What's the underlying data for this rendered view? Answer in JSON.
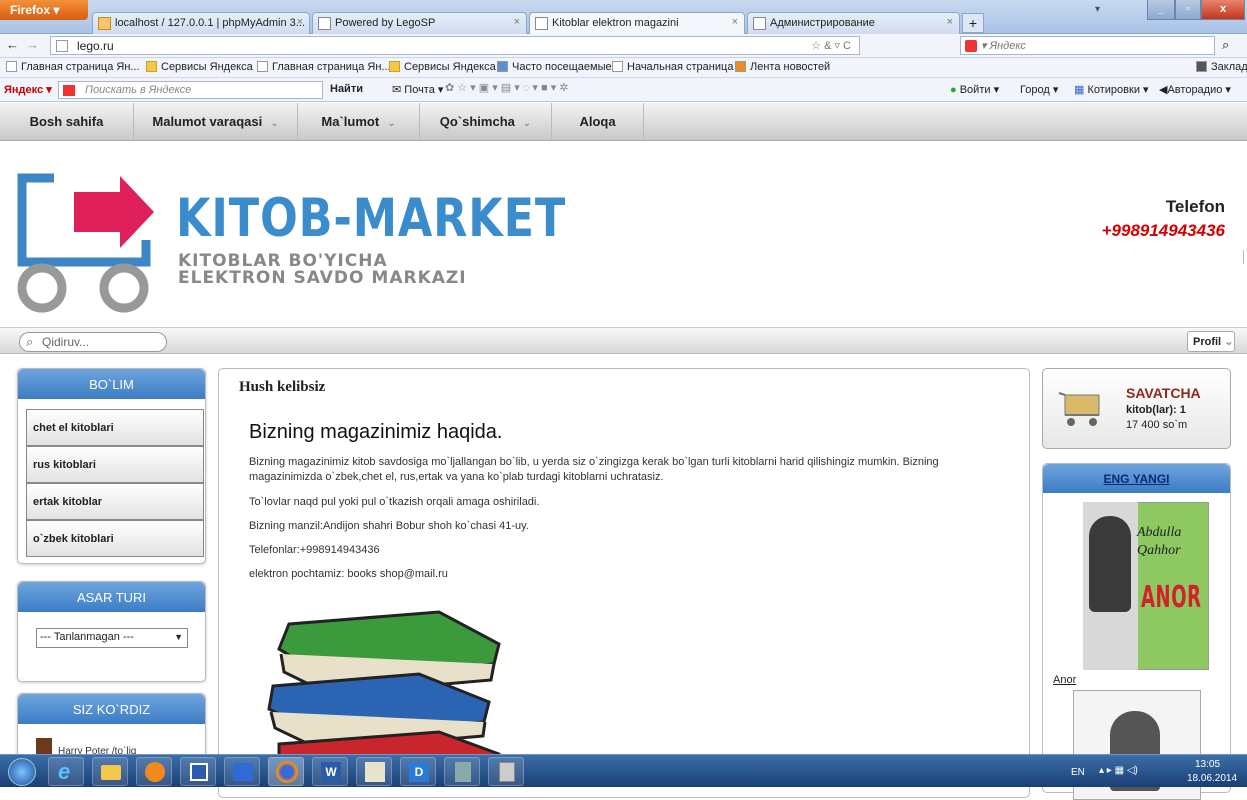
{
  "browser": {
    "app_button": "Firefox",
    "tabs": [
      {
        "label": "localhost / 127.0.0.1 | phpMyAdmin 3..."
      },
      {
        "label": "Powered by LegoSP"
      },
      {
        "label": "Kitoblar elektron magazini"
      },
      {
        "label": "Администрирование"
      }
    ],
    "url": "lego.ru",
    "search_placeholder": "Яндекс",
    "bookmarks": [
      "Главная страница Ян...",
      "Сервисы Яндекса",
      "Главная страница Ян...",
      "Сервисы Яндекса",
      "Часто посещаемые",
      "Начальная страница",
      "Лента новостей"
    ],
    "bookmarks_right": "Заклад",
    "yandex": {
      "logo": "Яндекс",
      "search_placeholder": "Поискать в Яндексе",
      "find": "Найти",
      "mail": "Почта",
      "login": "Войти",
      "city": "Город",
      "quotes": "Котировки",
      "radio": "Авторадио"
    }
  },
  "site": {
    "menu": [
      {
        "label": "Bosh sahifa",
        "arrow": false
      },
      {
        "label": "Malumot varaqasi",
        "arrow": true
      },
      {
        "label": "Ma`lumot",
        "arrow": true
      },
      {
        "label": "Qo`shimcha",
        "arrow": true
      },
      {
        "label": "Aloqa",
        "arrow": false
      }
    ],
    "brand": "KITOB-MARKET",
    "tagline1": "KITOBLAR BO'YICHA",
    "tagline2": "ELEKTRON SAVDO MARKAZI",
    "phone_label": "Telefon",
    "phone": "+998914943436",
    "search_placeholder": "Qidiruv...",
    "profile": "Profil",
    "sections": {
      "title": "BO`LIM",
      "items": [
        "chet el kitoblari",
        "rus kitoblari",
        "ertak kitoblar",
        "o`zbek kitoblari"
      ]
    },
    "genre": {
      "title": "ASAR TURI",
      "select": "--- Tanlanmagan ---"
    },
    "viewed": {
      "title": "SIZ KO`RDIZ",
      "item": "Harry Poter /to`liq"
    },
    "main": {
      "welcome": "Hush kelibsiz",
      "about_title": "Bizning magazinimiz haqida.",
      "p1": "Bizning magazinimiz kitob savdosiga mo`ljallangan bo`lib, u yerda siz o`zingizga kerak bo`lgan turli kitoblarni harid qilishingiz mumkin. Bizning magazinimizda o`zbek,chet el, rus,ertak va yana ko`plab turdagi kitoblarni uchratasiz.",
      "p2": "To`lovlar naqd pul yoki pul o`tkazish orqali amaga oshiriladi.",
      "p3": "Bizning manzil:Andijon shahri Bobur shoh ko`chasi 41-uy.",
      "p4": "Telefonlar:+998914943436",
      "p5": "elektron pochtamiz: books shop@mail.ru"
    },
    "cart": {
      "title": "SAVATCHA",
      "count_label": "kitob(lar):",
      "count": "1",
      "sum": "17 400 so`m"
    },
    "newest": {
      "title": "ENG YANGI",
      "book1_author": "Abdulla Qahhor",
      "book1_title": "ANOR",
      "book1_link": "Anor"
    }
  },
  "taskbar": {
    "lang": "EN",
    "time": "13:05",
    "date": "18.06.2014"
  },
  "colors": {
    "accent_blue": "#3c7cc4",
    "brand_blue": "#3a8ccd",
    "phone_red": "#d40000",
    "cart_red": "#8b2a1a"
  }
}
